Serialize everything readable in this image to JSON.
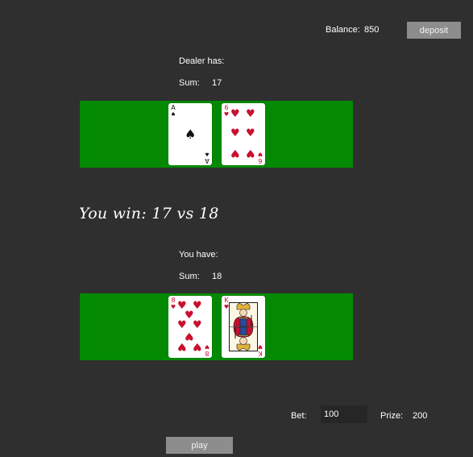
{
  "header": {
    "balance_label": "Balance:",
    "balance_value": "850",
    "deposit_label": "deposit"
  },
  "dealer": {
    "label": "Dealer has:",
    "sum_label": "Sum:",
    "sum_value": "17",
    "cards": [
      {
        "rank": "A",
        "suit": "♠",
        "suit_name": "spades",
        "color": "#111111"
      },
      {
        "rank": "6",
        "suit": "♥",
        "suit_name": "hearts",
        "color": "#c8102e"
      }
    ]
  },
  "result": {
    "message": "You win: 17 vs 18"
  },
  "player": {
    "label": "You have:",
    "sum_label": "Sum:",
    "sum_value": "18",
    "cards": [
      {
        "rank": "8",
        "suit": "♥",
        "suit_name": "hearts",
        "color": "#c8102e"
      },
      {
        "rank": "K",
        "suit": "♥",
        "suit_name": "hearts",
        "color": "#c8102e"
      }
    ]
  },
  "controls": {
    "bet_label": "Bet:",
    "bet_value": "100",
    "prize_label": "Prize:",
    "prize_value": "200",
    "play_label": "play"
  },
  "colors": {
    "background": "#2f2f2f",
    "table_felt": "#038a02",
    "button": "#8d8d8d",
    "heart_red": "#c8102e"
  }
}
